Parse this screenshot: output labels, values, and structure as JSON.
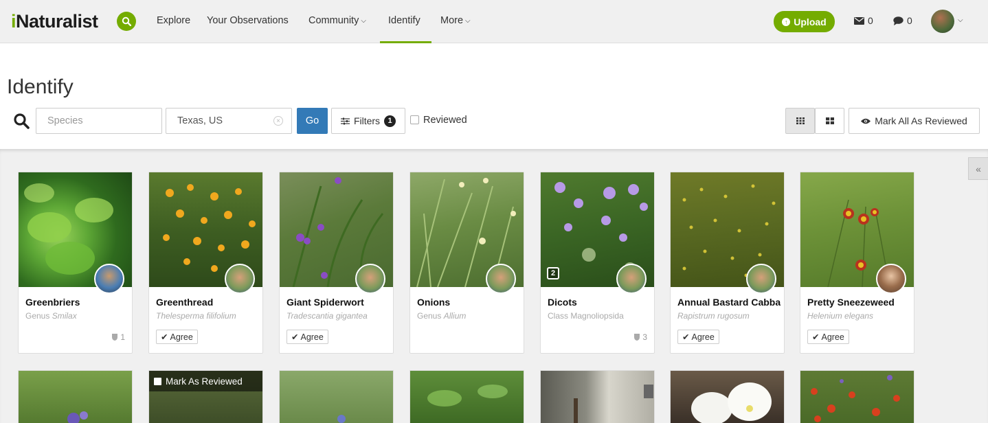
{
  "header": {
    "logo_text": "Naturalist",
    "logo_i": "i",
    "nav": [
      {
        "label": "Explore"
      },
      {
        "label": "Your Observations"
      },
      {
        "label": "Community"
      },
      {
        "label": "Identify"
      },
      {
        "label": "More"
      }
    ],
    "upload_label": "Upload",
    "messages_count": "0",
    "notifications_count": "0",
    "accent": "#74ac00"
  },
  "page": {
    "title": "Identify"
  },
  "toolbar": {
    "species_placeholder": "Species",
    "place_value": "Texas, US",
    "go_label": "Go",
    "filters_label": "Filters",
    "filters_count": "1",
    "reviewed_label": "Reviewed",
    "mark_all_label": "Mark All As Reviewed"
  },
  "cards": [
    {
      "common": "Greenbriers",
      "rank": "Genus",
      "sci": "Smilax",
      "action": "",
      "id_count": "1",
      "photo_count": ""
    },
    {
      "common": "Greenthread",
      "rank": "",
      "sci": "Thelesperma filifolium",
      "action": "Agree",
      "id_count": "",
      "photo_count": ""
    },
    {
      "common": "Giant Spiderwort",
      "rank": "",
      "sci": "Tradescantia gigantea",
      "action": "Agree",
      "id_count": "",
      "photo_count": ""
    },
    {
      "common": "Onions",
      "rank": "Genus",
      "sci": "Allium",
      "action": "",
      "id_count": "",
      "photo_count": ""
    },
    {
      "common": "Dicots",
      "rank": "Class",
      "sci": "Magnoliopsida",
      "action": "",
      "id_count": "3",
      "photo_count": "2"
    },
    {
      "common": "Annual Bastard Cabba",
      "rank": "",
      "sci": "Rapistrum rugosum",
      "action": "Agree",
      "id_count": "",
      "photo_count": ""
    },
    {
      "common": "Pretty Sneezeweed",
      "rank": "",
      "sci": "Helenium elegans",
      "action": "Agree",
      "id_count": "",
      "photo_count": ""
    }
  ],
  "row2": {
    "mark_reviewed_label": "Mark As Reviewed"
  }
}
